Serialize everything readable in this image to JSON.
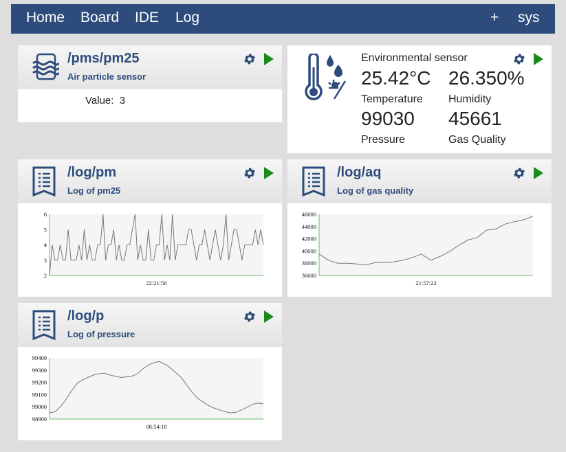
{
  "nav": {
    "home": "Home",
    "board": "Board",
    "ide": "IDE",
    "log": "Log",
    "add": "+",
    "sys": "sys"
  },
  "cards": {
    "pm25": {
      "title": "/pms/pm25",
      "subtitle": "Air particle sensor",
      "value_label": "Value:",
      "value": "3"
    },
    "env": {
      "title": "Environmental sensor",
      "temperature": "25.42°C",
      "temperature_label": "Temperature",
      "humidity": "26.350%",
      "humidity_label": "Humidity",
      "pressure": "99030",
      "pressure_label": "Pressure",
      "gas": "45661",
      "gas_label": "Gas Quality"
    },
    "logpm": {
      "title": "/log/pm",
      "subtitle": "Log of pm25"
    },
    "logaq": {
      "title": "/log/aq",
      "subtitle": "Log of gas quality"
    },
    "logp": {
      "title": "/log/p",
      "subtitle": "Log of pressure"
    }
  },
  "colors": {
    "nav": "#2d4c7c",
    "accent": "#2d4c7c",
    "play": "#1a8a1a",
    "axis": "#66bb66",
    "line": "#777777"
  },
  "icons": {
    "pm25": "air-waves-icon",
    "env": "thermometer-weather-icon",
    "log": "log-document-icon",
    "settings": "gear-icon",
    "run": "play-icon"
  },
  "chart_data": [
    {
      "type": "line",
      "name": "logpm",
      "ylim": [
        2,
        6
      ],
      "yticks": [
        2,
        3,
        4,
        5,
        6
      ],
      "xlabel": "22:21:58",
      "values": [
        2,
        4,
        3,
        3,
        4,
        3,
        3,
        5,
        3,
        3,
        3,
        4,
        3,
        5,
        3,
        4,
        3,
        3,
        4,
        4,
        6,
        3,
        4,
        4,
        5,
        3,
        4,
        3,
        3,
        4,
        4,
        5,
        6,
        3,
        4,
        3,
        3,
        5,
        3,
        3,
        4,
        4,
        6,
        3,
        4,
        3,
        6,
        3,
        4,
        4,
        4,
        4,
        5,
        5,
        4,
        3,
        4,
        4,
        5,
        4,
        3,
        4,
        5,
        4,
        3,
        4,
        6,
        3,
        4,
        5,
        5,
        4,
        3,
        4,
        4,
        4,
        4,
        5,
        4,
        5,
        4
      ]
    },
    {
      "type": "line",
      "name": "logaq",
      "ylim": [
        36000,
        46000
      ],
      "yticks": [
        36000,
        38000,
        40000,
        42000,
        44000,
        46000
      ],
      "xlabel": "21:57:22",
      "values": [
        39500,
        38500,
        38000,
        38000,
        37900,
        37700,
        38100,
        38100,
        38200,
        38500,
        38900,
        39500,
        38500,
        39100,
        39900,
        40900,
        41800,
        42200,
        43400,
        43600,
        44400,
        44800,
        45100,
        45700
      ]
    },
    {
      "type": "line",
      "name": "logp",
      "ylim": [
        98900,
        99400
      ],
      "yticks": [
        98900,
        99000,
        99100,
        99200,
        99300,
        99400
      ],
      "xlabel": "08:54:18",
      "values": [
        98950,
        98960,
        99000,
        99060,
        99130,
        99190,
        99220,
        99240,
        99260,
        99270,
        99275,
        99260,
        99250,
        99240,
        99245,
        99250,
        99270,
        99310,
        99340,
        99360,
        99370,
        99350,
        99320,
        99280,
        99240,
        99180,
        99120,
        99070,
        99040,
        99010,
        98990,
        98975,
        98960,
        98950,
        98955,
        98975,
        98995,
        99020,
        99030,
        99025
      ]
    }
  ]
}
